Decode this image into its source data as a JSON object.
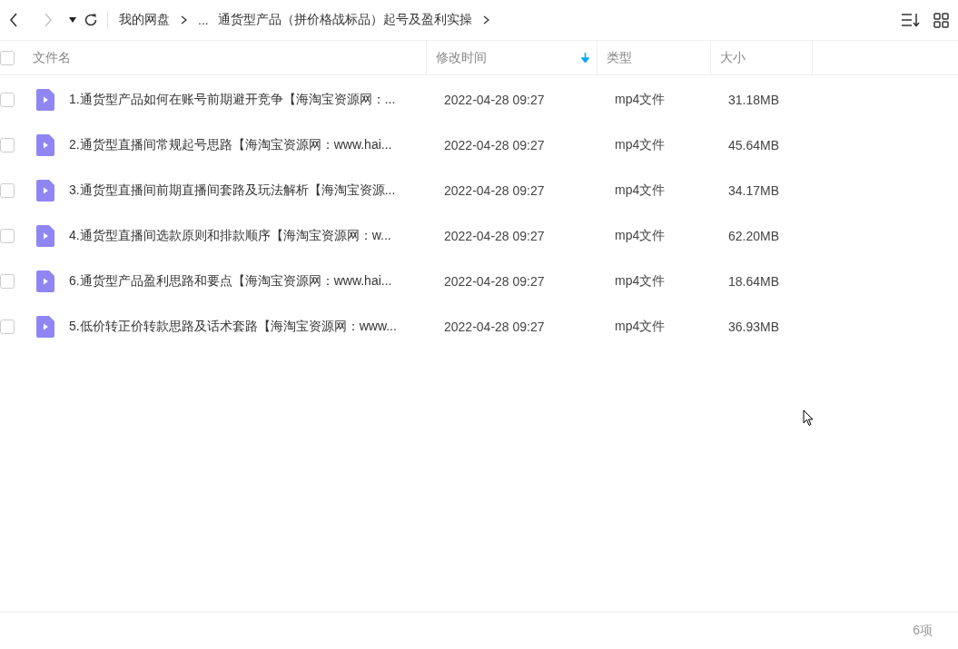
{
  "breadcrumb": [
    {
      "label": "我的网盘"
    },
    {
      "label": "..."
    },
    {
      "label": "通货型产品（拼价格战标品）起号及盈利实操"
    }
  ],
  "table": {
    "select_all": {
      "checked": false
    },
    "columns": [
      {
        "label": "文件名",
        "sorted": false
      },
      {
        "label": "修改时间",
        "sorted": true
      },
      {
        "label": "类型",
        "sorted": false
      },
      {
        "label": "大小",
        "sorted": false
      }
    ],
    "rows": [
      {
        "checked": false,
        "name": "1.通货型产品如何在账号前期避开竞争【海淘宝资源网：...",
        "modified": "2022-04-28 09:27",
        "type": "mp4文件",
        "size": "31.18MB"
      },
      {
        "checked": false,
        "name": "2.通货型直播间常规起号思路【海淘宝资源网：www.hai...",
        "modified": "2022-04-28 09:27",
        "type": "mp4文件",
        "size": "45.64MB"
      },
      {
        "checked": false,
        "name": "3.通货型直播间前期直播间套路及玩法解析【海淘宝资源...",
        "modified": "2022-04-28 09:27",
        "type": "mp4文件",
        "size": "34.17MB"
      },
      {
        "checked": false,
        "name": "4.通货型直播间选款原则和排款顺序【海淘宝资源网：w...",
        "modified": "2022-04-28 09:27",
        "type": "mp4文件",
        "size": "62.20MB"
      },
      {
        "checked": false,
        "name": "6.通货型产品盈利思路和要点【海淘宝资源网：www.hai...",
        "modified": "2022-04-28 09:27",
        "type": "mp4文件",
        "size": "18.64MB"
      },
      {
        "checked": false,
        "name": "5.低价转正价转款思路及话术套路【海淘宝资源网：www...",
        "modified": "2022-04-28 09:27",
        "type": "mp4文件",
        "size": "36.93MB"
      }
    ]
  },
  "status_bar": {
    "count": "6项"
  }
}
